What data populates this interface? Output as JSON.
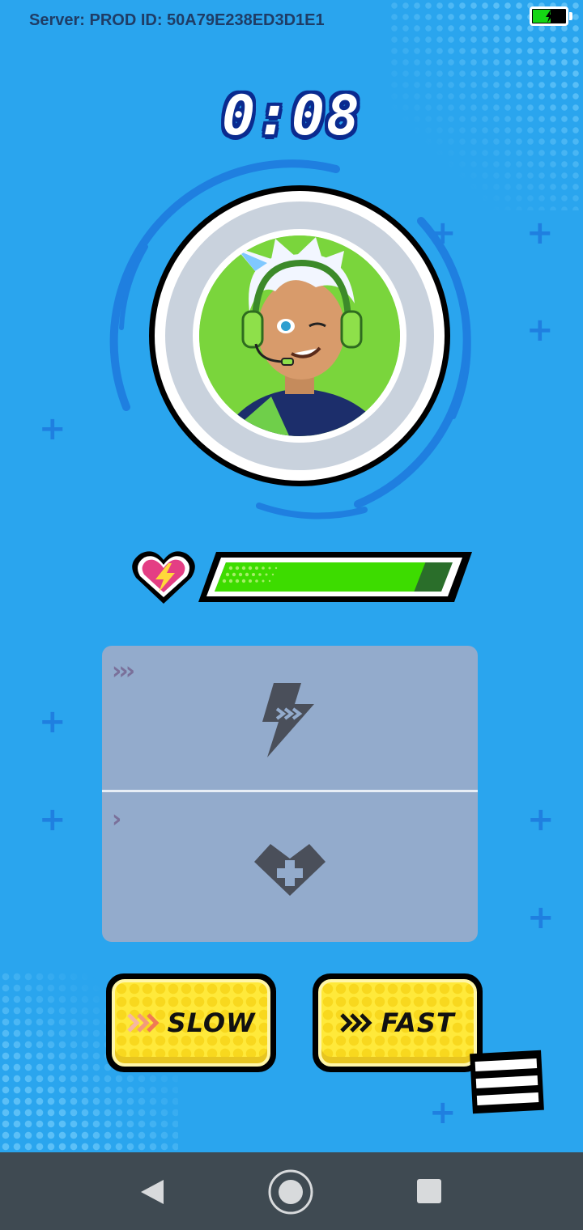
{
  "status_bar": {
    "server_text": "Server: PROD ID: 50A79E238ED3D1E1",
    "battery_level": 0.55
  },
  "game": {
    "timer": "0:08",
    "health_fraction": 0.88,
    "power_up_slots": [
      {
        "name": "speed-boost",
        "level_chevrons": 3,
        "icon": "lightning-icon"
      },
      {
        "name": "heal",
        "level_chevrons": 1,
        "icon": "heart-plus-icon"
      }
    ],
    "buttons": {
      "slow_label": "SLOW",
      "fast_label": "FAST"
    },
    "avatar": "player-avatar-headset"
  },
  "colors": {
    "background": "#2aa5ee",
    "health_fill": "#3ddc00",
    "button_yellow": "#ffe93a",
    "timer_outline": "#0a2a8f"
  },
  "navigation": {
    "buttons": [
      "back-icon",
      "home-icon",
      "recents-icon"
    ]
  }
}
